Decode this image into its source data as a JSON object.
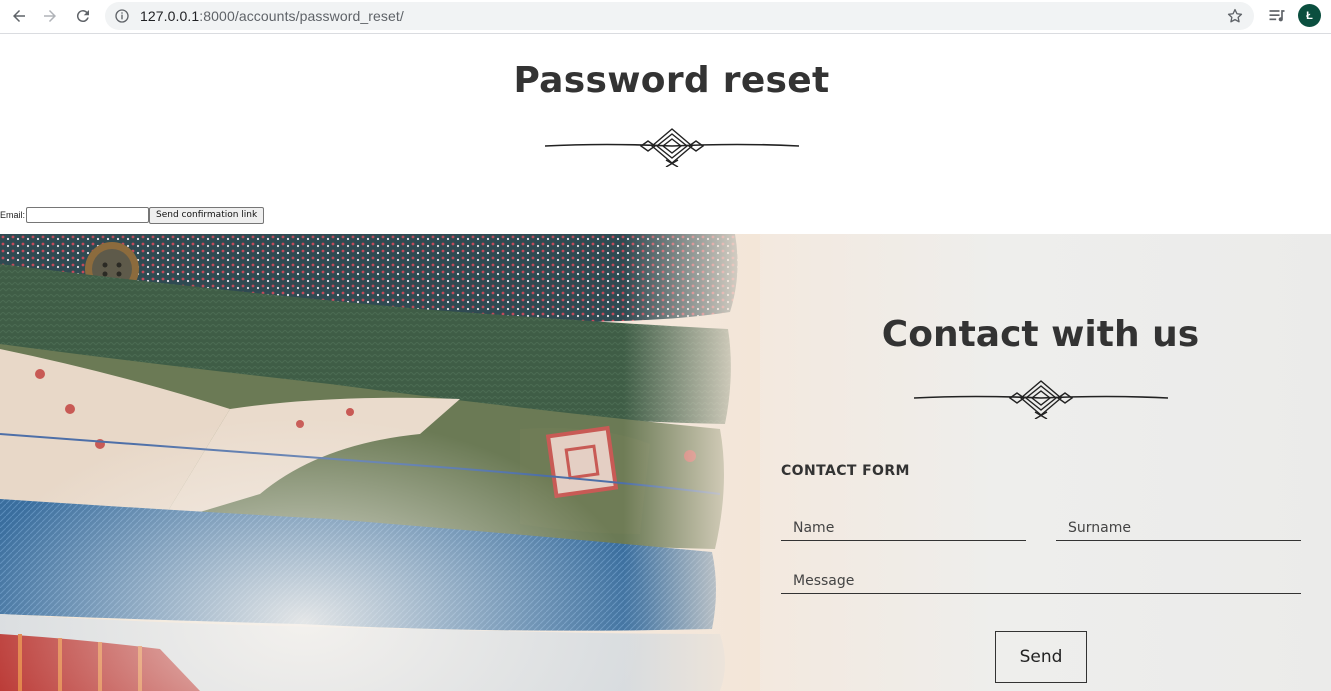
{
  "browser": {
    "url_host": "127.0.0.1",
    "url_path": ":8000/accounts/password_reset/",
    "avatar_letter": "Ł",
    "accent": "#0b4f3f"
  },
  "page": {
    "title": "Password reset"
  },
  "reset_form": {
    "email_label": "Email:",
    "email_value": "",
    "submit_label": "Send confirmation link"
  },
  "contact": {
    "title": "Contact with us",
    "form_heading": "CONTACT FORM",
    "name_placeholder": "Name",
    "surname_placeholder": "Surname",
    "message_placeholder": "Message",
    "send_label": "Send"
  },
  "icons": {
    "back": "back-arrow-icon",
    "forward": "forward-arrow-icon",
    "reload": "reload-icon",
    "info": "info-icon",
    "star": "bookmark-star-icon",
    "playlist": "media-playlist-icon",
    "ornament": "ornament-divider-icon"
  }
}
